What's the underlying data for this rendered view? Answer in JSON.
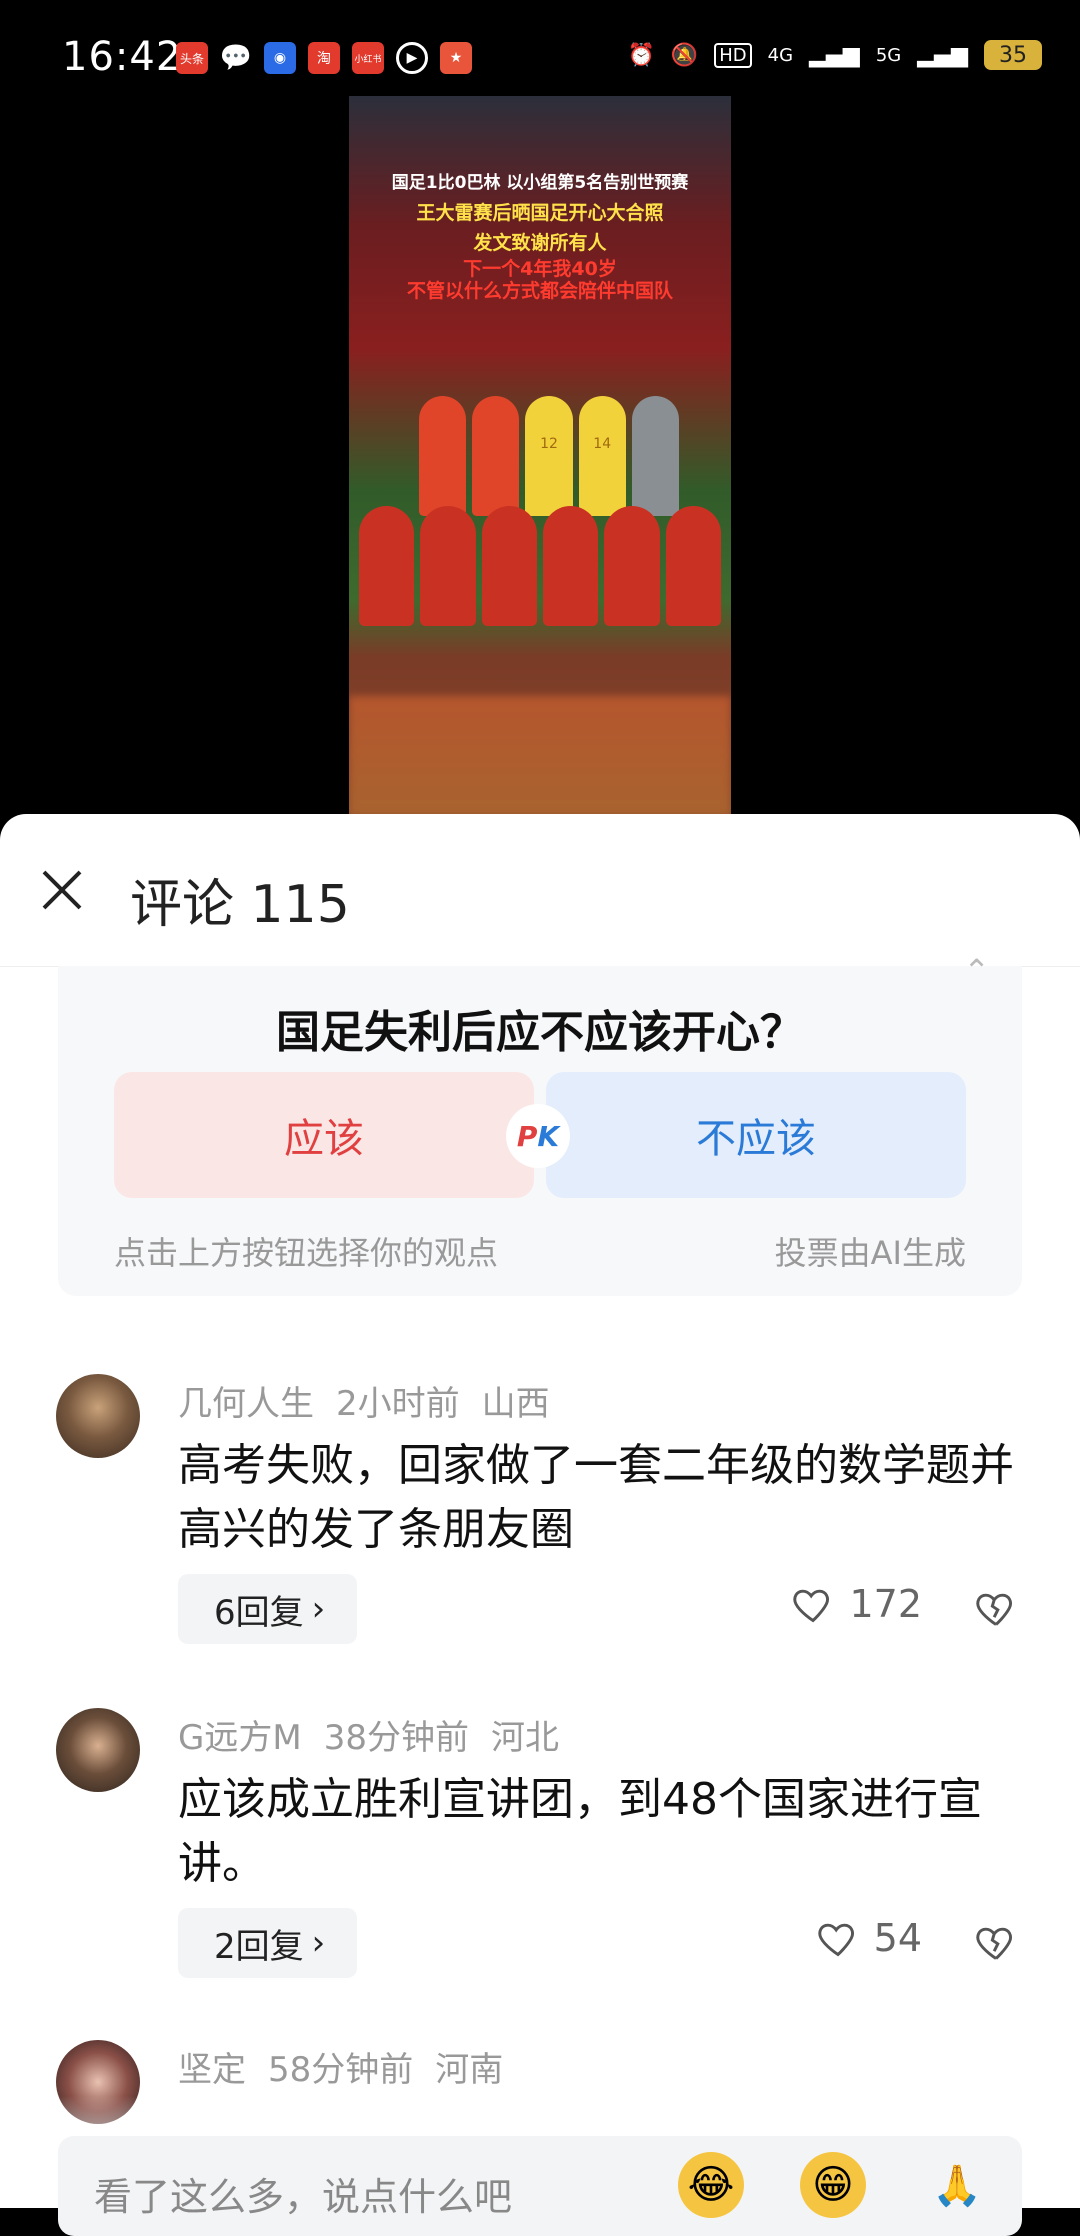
{
  "status_bar": {
    "time": "16:42",
    "app_labels": [
      "头条",
      "淘",
      "小红书"
    ],
    "indicators": [
      "HD",
      "4G",
      "5G"
    ],
    "battery": "35"
  },
  "video": {
    "captions": [
      "国足1比0巴林 以小组第5名告别世预赛",
      "王大雷赛后晒国足开心大合照",
      "发文致谢所有人",
      "下一个4年我40岁",
      "不管以什么方式都会陪伴中国队"
    ],
    "jersey_numbers": [
      "12",
      "14"
    ]
  },
  "comment_sheet": {
    "title": "评论 115"
  },
  "poll": {
    "question": "国足失利后应不应该开心？",
    "option_yes": "应该",
    "option_no": "不应该",
    "pk_p": "P",
    "pk_k": "K",
    "hint": "点击上方按钮选择你的观点",
    "source": "投票由AI生成"
  },
  "comments": [
    {
      "user": "几何人生",
      "time": "2小时前",
      "location": "山西",
      "text": "高考失败，回家做了一套二年级的数学题并高兴的发了条朋友圈",
      "replies": "6回复",
      "likes": "172"
    },
    {
      "user": "G远方M",
      "time": "38分钟前",
      "location": "河北",
      "text": "应该成立胜利宣讲团，到48个国家进行宣讲。",
      "replies": "2回复",
      "likes": "54"
    },
    {
      "user": "坚定",
      "time": "58分钟前",
      "location": "河南"
    }
  ],
  "input_bar": {
    "placeholder": "看了这么多，说点什么吧",
    "emojis": [
      "😂",
      "😁",
      "🙏"
    ]
  }
}
